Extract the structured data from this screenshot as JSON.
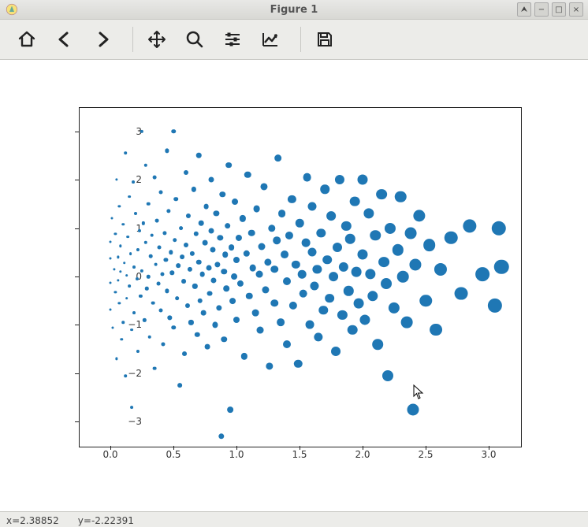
{
  "window": {
    "title": "Figure 1"
  },
  "toolbar": {
    "home": "Home",
    "back": "Back",
    "forward": "Forward",
    "pan": "Pan",
    "zoom": "Zoom",
    "subplots": "Configure subplots",
    "edit": "Edit axis",
    "save": "Save"
  },
  "statusbar": {
    "x_label": "x=2.38852",
    "y_label": "y=-2.22391"
  },
  "chart_data": {
    "type": "scatter",
    "title": "",
    "xlabel": "",
    "ylabel": "",
    "xlim": [
      -0.25,
      3.25
    ],
    "ylim": [
      -3.5,
      3.5
    ],
    "xticks": [
      0.0,
      0.5,
      1.0,
      1.5,
      2.0,
      2.5,
      3.0
    ],
    "yticks": [
      -3,
      -2,
      -1,
      0,
      1,
      2,
      3
    ],
    "xtick_labels": [
      "0.0",
      "0.5",
      "1.0",
      "1.5",
      "2.0",
      "2.5",
      "3.0"
    ],
    "ytick_labels": [
      "−3",
      "−2",
      "−1",
      "0",
      "1",
      "2",
      "3"
    ],
    "marker_size_encodes": "x",
    "points": [
      {
        "x": 0.0,
        "y": 0.72
      },
      {
        "x": 0.0,
        "y": 0.38
      },
      {
        "x": 0.0,
        "y": -0.13
      },
      {
        "x": 0.0,
        "y": -0.69
      },
      {
        "x": 0.01,
        "y": 1.2
      },
      {
        "x": 0.02,
        "y": -1.05
      },
      {
        "x": 0.03,
        "y": 0.15
      },
      {
        "x": 0.04,
        "y": -0.33
      },
      {
        "x": 0.04,
        "y": 0.88
      },
      {
        "x": 0.05,
        "y": 2.0
      },
      {
        "x": 0.05,
        "y": -1.7
      },
      {
        "x": 0.06,
        "y": 0.4
      },
      {
        "x": 0.06,
        "y": -0.08
      },
      {
        "x": 0.07,
        "y": 1.45
      },
      {
        "x": 0.07,
        "y": -0.55
      },
      {
        "x": 0.08,
        "y": 0.1
      },
      {
        "x": 0.08,
        "y": 0.63
      },
      {
        "x": 0.09,
        "y": -1.3
      },
      {
        "x": 0.1,
        "y": -0.95
      },
      {
        "x": 0.1,
        "y": 1.08
      },
      {
        "x": 0.11,
        "y": 0.28
      },
      {
        "x": 0.12,
        "y": -2.05
      },
      {
        "x": 0.12,
        "y": 2.55
      },
      {
        "x": 0.13,
        "y": 0.02
      },
      {
        "x": 0.13,
        "y": -0.45
      },
      {
        "x": 0.14,
        "y": 0.82
      },
      {
        "x": 0.15,
        "y": -0.2
      },
      {
        "x": 0.15,
        "y": 1.65
      },
      {
        "x": 0.16,
        "y": 0.47
      },
      {
        "x": 0.17,
        "y": -1.1
      },
      {
        "x": 0.17,
        "y": -2.7
      },
      {
        "x": 0.18,
        "y": 1.95
      },
      {
        "x": 0.19,
        "y": 0.2
      },
      {
        "x": 0.19,
        "y": -0.75
      },
      {
        "x": 0.2,
        "y": 1.3
      },
      {
        "x": 0.21,
        "y": -0.05
      },
      {
        "x": 0.22,
        "y": 0.55
      },
      {
        "x": 0.22,
        "y": -1.55
      },
      {
        "x": 0.23,
        "y": 0.95
      },
      {
        "x": 0.24,
        "y": -0.4
      },
      {
        "x": 0.25,
        "y": 3.0
      },
      {
        "x": 0.25,
        "y": 0.12
      },
      {
        "x": 0.26,
        "y": 1.1
      },
      {
        "x": 0.27,
        "y": -0.9
      },
      {
        "x": 0.28,
        "y": 2.3
      },
      {
        "x": 0.28,
        "y": 0.7
      },
      {
        "x": 0.29,
        "y": -0.25
      },
      {
        "x": 0.3,
        "y": 0.0
      },
      {
        "x": 0.3,
        "y": 1.5
      },
      {
        "x": 0.31,
        "y": -1.25
      },
      {
        "x": 0.32,
        "y": 0.42
      },
      {
        "x": 0.33,
        "y": 0.85
      },
      {
        "x": 0.34,
        "y": -0.55
      },
      {
        "x": 0.35,
        "y": 2.05
      },
      {
        "x": 0.35,
        "y": -1.9
      },
      {
        "x": 0.36,
        "y": 0.25
      },
      {
        "x": 0.37,
        "y": 1.15
      },
      {
        "x": 0.38,
        "y": -0.15
      },
      {
        "x": 0.39,
        "y": 0.6
      },
      {
        "x": 0.4,
        "y": -0.7
      },
      {
        "x": 0.4,
        "y": 1.75
      },
      {
        "x": 0.41,
        "y": 0.05
      },
      {
        "x": 0.42,
        "y": -1.4
      },
      {
        "x": 0.43,
        "y": 0.9
      },
      {
        "x": 0.44,
        "y": 0.35
      },
      {
        "x": 0.45,
        "y": 2.6
      },
      {
        "x": 0.45,
        "y": -0.3
      },
      {
        "x": 0.46,
        "y": 1.35
      },
      {
        "x": 0.47,
        "y": -0.85
      },
      {
        "x": 0.48,
        "y": 0.5
      },
      {
        "x": 0.49,
        "y": 0.08
      },
      {
        "x": 0.5,
        "y": -1.05
      },
      {
        "x": 0.5,
        "y": 3.0
      },
      {
        "x": 0.51,
        "y": 0.75
      },
      {
        "x": 0.52,
        "y": 1.6
      },
      {
        "x": 0.53,
        "y": -0.45
      },
      {
        "x": 0.54,
        "y": 0.22
      },
      {
        "x": 0.55,
        "y": -2.25
      },
      {
        "x": 0.56,
        "y": 1.0
      },
      {
        "x": 0.57,
        "y": 0.4
      },
      {
        "x": 0.58,
        "y": -0.1
      },
      {
        "x": 0.59,
        "y": -1.6
      },
      {
        "x": 0.6,
        "y": 0.65
      },
      {
        "x": 0.6,
        "y": 2.15
      },
      {
        "x": 0.61,
        "y": -0.6
      },
      {
        "x": 0.62,
        "y": 1.25
      },
      {
        "x": 0.63,
        "y": 0.15
      },
      {
        "x": 0.64,
        "y": -0.95
      },
      {
        "x": 0.65,
        "y": 0.48
      },
      {
        "x": 0.66,
        "y": 1.8
      },
      {
        "x": 0.67,
        "y": -0.2
      },
      {
        "x": 0.68,
        "y": 0.88
      },
      {
        "x": 0.69,
        "y": -1.2
      },
      {
        "x": 0.7,
        "y": 0.3
      },
      {
        "x": 0.7,
        "y": 2.5
      },
      {
        "x": 0.71,
        "y": -0.5
      },
      {
        "x": 0.72,
        "y": 1.1
      },
      {
        "x": 0.73,
        "y": 0.05
      },
      {
        "x": 0.74,
        "y": -0.75
      },
      {
        "x": 0.75,
        "y": 0.7
      },
      {
        "x": 0.76,
        "y": 1.45
      },
      {
        "x": 0.77,
        "y": -1.45
      },
      {
        "x": 0.78,
        "y": 0.18
      },
      {
        "x": 0.79,
        "y": -0.35
      },
      {
        "x": 0.8,
        "y": 0.95
      },
      {
        "x": 0.8,
        "y": 2.0
      },
      {
        "x": 0.81,
        "y": 0.55
      },
      {
        "x": 0.82,
        "y": -0.08
      },
      {
        "x": 0.83,
        "y": -1.0
      },
      {
        "x": 0.84,
        "y": 1.3
      },
      {
        "x": 0.85,
        "y": 0.25
      },
      {
        "x": 0.86,
        "y": -0.65
      },
      {
        "x": 0.87,
        "y": 0.8
      },
      {
        "x": 0.88,
        "y": -3.3
      },
      {
        "x": 0.89,
        "y": 1.7
      },
      {
        "x": 0.9,
        "y": 0.1
      },
      {
        "x": 0.9,
        "y": -1.3
      },
      {
        "x": 0.91,
        "y": 0.45
      },
      {
        "x": 0.92,
        "y": -0.25
      },
      {
        "x": 0.93,
        "y": 1.05
      },
      {
        "x": 0.94,
        "y": 2.3
      },
      {
        "x": 0.95,
        "y": -2.75
      },
      {
        "x": 0.96,
        "y": 0.6
      },
      {
        "x": 0.97,
        "y": -0.5
      },
      {
        "x": 0.98,
        "y": 0.0
      },
      {
        "x": 0.99,
        "y": 1.55
      },
      {
        "x": 1.0,
        "y": 0.35
      },
      {
        "x": 1.0,
        "y": -0.9
      },
      {
        "x": 1.02,
        "y": 0.8
      },
      {
        "x": 1.03,
        "y": -0.15
      },
      {
        "x": 1.05,
        "y": 1.2
      },
      {
        "x": 1.06,
        "y": -1.65
      },
      {
        "x": 1.08,
        "y": 0.48
      },
      {
        "x": 1.09,
        "y": 2.1
      },
      {
        "x": 1.1,
        "y": -0.4
      },
      {
        "x": 1.12,
        "y": 0.9
      },
      {
        "x": 1.13,
        "y": 0.18
      },
      {
        "x": 1.15,
        "y": -0.75
      },
      {
        "x": 1.16,
        "y": 1.4
      },
      {
        "x": 1.18,
        "y": 0.05
      },
      {
        "x": 1.19,
        "y": -1.1
      },
      {
        "x": 1.2,
        "y": 0.62
      },
      {
        "x": 1.22,
        "y": 1.85
      },
      {
        "x": 1.23,
        "y": -0.28
      },
      {
        "x": 1.25,
        "y": 0.3
      },
      {
        "x": 1.26,
        "y": -1.85
      },
      {
        "x": 1.28,
        "y": 1.0
      },
      {
        "x": 1.3,
        "y": 0.15
      },
      {
        "x": 1.3,
        "y": -0.55
      },
      {
        "x": 1.32,
        "y": 0.75
      },
      {
        "x": 1.33,
        "y": 2.45
      },
      {
        "x": 1.35,
        "y": -0.95
      },
      {
        "x": 1.36,
        "y": 1.3
      },
      {
        "x": 1.38,
        "y": 0.45
      },
      {
        "x": 1.4,
        "y": -0.1
      },
      {
        "x": 1.4,
        "y": -1.4
      },
      {
        "x": 1.42,
        "y": 0.85
      },
      {
        "x": 1.44,
        "y": 1.6
      },
      {
        "x": 1.45,
        "y": -0.6
      },
      {
        "x": 1.47,
        "y": 0.25
      },
      {
        "x": 1.49,
        "y": -1.8
      },
      {
        "x": 1.5,
        "y": 1.1
      },
      {
        "x": 1.52,
        "y": 0.05
      },
      {
        "x": 1.53,
        "y": -0.35
      },
      {
        "x": 1.55,
        "y": 0.7
      },
      {
        "x": 1.56,
        "y": 2.05
      },
      {
        "x": 1.58,
        "y": -1.0
      },
      {
        "x": 1.6,
        "y": 0.5
      },
      {
        "x": 1.6,
        "y": 1.45
      },
      {
        "x": 1.62,
        "y": -0.2
      },
      {
        "x": 1.64,
        "y": 0.15
      },
      {
        "x": 1.65,
        "y": -1.25
      },
      {
        "x": 1.67,
        "y": 0.9
      },
      {
        "x": 1.69,
        "y": -0.7
      },
      {
        "x": 1.7,
        "y": 1.8
      },
      {
        "x": 1.72,
        "y": 0.35
      },
      {
        "x": 1.74,
        "y": -0.45
      },
      {
        "x": 1.75,
        "y": 1.25
      },
      {
        "x": 1.77,
        "y": 0.0
      },
      {
        "x": 1.79,
        "y": -1.55
      },
      {
        "x": 1.8,
        "y": 0.6
      },
      {
        "x": 1.82,
        "y": 2.0
      },
      {
        "x": 1.84,
        "y": -0.8
      },
      {
        "x": 1.85,
        "y": 0.2
      },
      {
        "x": 1.87,
        "y": 1.05
      },
      {
        "x": 1.89,
        "y": -0.3
      },
      {
        "x": 1.9,
        "y": 0.78
      },
      {
        "x": 1.92,
        "y": -1.1
      },
      {
        "x": 1.94,
        "y": 1.55
      },
      {
        "x": 1.95,
        "y": 0.1
      },
      {
        "x": 1.97,
        "y": -0.55
      },
      {
        "x": 2.0,
        "y": 0.45
      },
      {
        "x": 2.0,
        "y": 2.0
      },
      {
        "x": 2.02,
        "y": -0.9
      },
      {
        "x": 2.05,
        "y": 1.3
      },
      {
        "x": 2.06,
        "y": 0.05
      },
      {
        "x": 2.08,
        "y": -0.4
      },
      {
        "x": 2.1,
        "y": 0.85
      },
      {
        "x": 2.12,
        "y": -1.4
      },
      {
        "x": 2.15,
        "y": 1.7
      },
      {
        "x": 2.17,
        "y": 0.3
      },
      {
        "x": 2.19,
        "y": -0.15
      },
      {
        "x": 2.2,
        "y": -2.05
      },
      {
        "x": 2.22,
        "y": 1.0
      },
      {
        "x": 2.25,
        "y": -0.65
      },
      {
        "x": 2.28,
        "y": 0.55
      },
      {
        "x": 2.3,
        "y": 1.65
      },
      {
        "x": 2.32,
        "y": 0.0
      },
      {
        "x": 2.35,
        "y": -0.95
      },
      {
        "x": 2.38,
        "y": 0.9
      },
      {
        "x": 2.4,
        "y": -2.75
      },
      {
        "x": 2.42,
        "y": 0.25
      },
      {
        "x": 2.45,
        "y": 1.25
      },
      {
        "x": 2.5,
        "y": -0.5
      },
      {
        "x": 2.53,
        "y": 0.65
      },
      {
        "x": 2.58,
        "y": -1.1
      },
      {
        "x": 2.62,
        "y": 0.15
      },
      {
        "x": 2.7,
        "y": 0.8
      },
      {
        "x": 2.78,
        "y": -0.35
      },
      {
        "x": 2.85,
        "y": 1.05
      },
      {
        "x": 2.95,
        "y": 0.05
      },
      {
        "x": 3.05,
        "y": -0.6
      },
      {
        "x": 3.08,
        "y": 1.0
      },
      {
        "x": 3.1,
        "y": 0.2
      }
    ]
  }
}
